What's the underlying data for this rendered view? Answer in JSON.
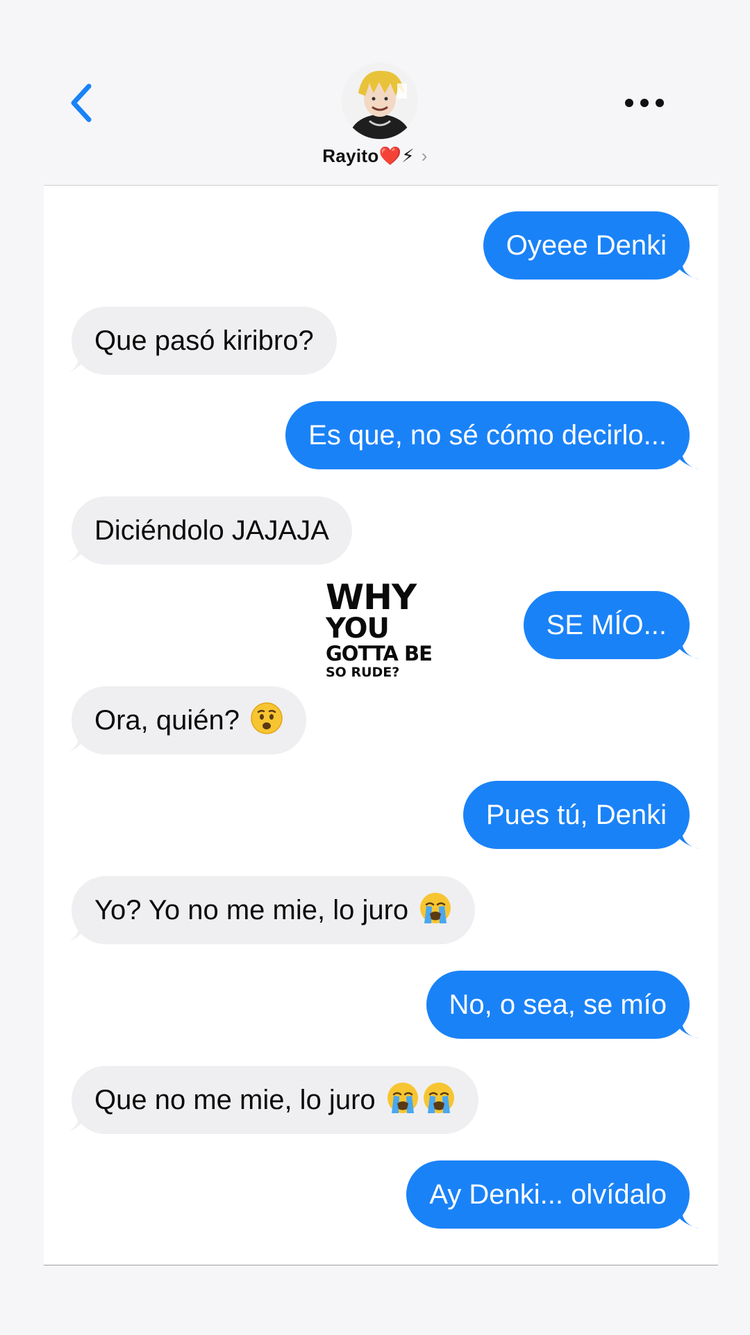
{
  "header": {
    "contact_name": "Rayito❤️⚡",
    "chevron": "›",
    "back_icon": "chevron-left-icon",
    "more_icon": "ellipsis-icon"
  },
  "colors": {
    "accent": "#1a82f7",
    "incoming_bubble": "#efeff1",
    "background": "#f6f6f8"
  },
  "messages": [
    {
      "from": "me",
      "text": "Oyeee Denki"
    },
    {
      "from": "them",
      "text": "Que pasó kiribro?"
    },
    {
      "from": "me",
      "text": "Es que, no sé cómo decirlo..."
    },
    {
      "from": "them",
      "text": "Diciéndolo JAJAJA"
    },
    {
      "from": "me",
      "text": "SE MÍO..."
    },
    {
      "from": "them",
      "text": "Ora, quién?",
      "emoji": "worried-face-icon"
    },
    {
      "from": "me",
      "text": "Pues tú, Denki"
    },
    {
      "from": "them",
      "text": "Yo? Yo no me mie, lo juro",
      "emoji": "loudly-crying-face-icon"
    },
    {
      "from": "me",
      "text": "No, o sea, se mío"
    },
    {
      "from": "them",
      "text": "Que no me mie, lo juro",
      "emoji": "loudly-crying-face-icon x2"
    },
    {
      "from": "me",
      "text": "Ay Denki... olvídalo"
    }
  ],
  "sticker": {
    "line1": "WHY",
    "line2": "YOU",
    "line3": "GOTTA BE",
    "line4": "SO RUDE?"
  }
}
